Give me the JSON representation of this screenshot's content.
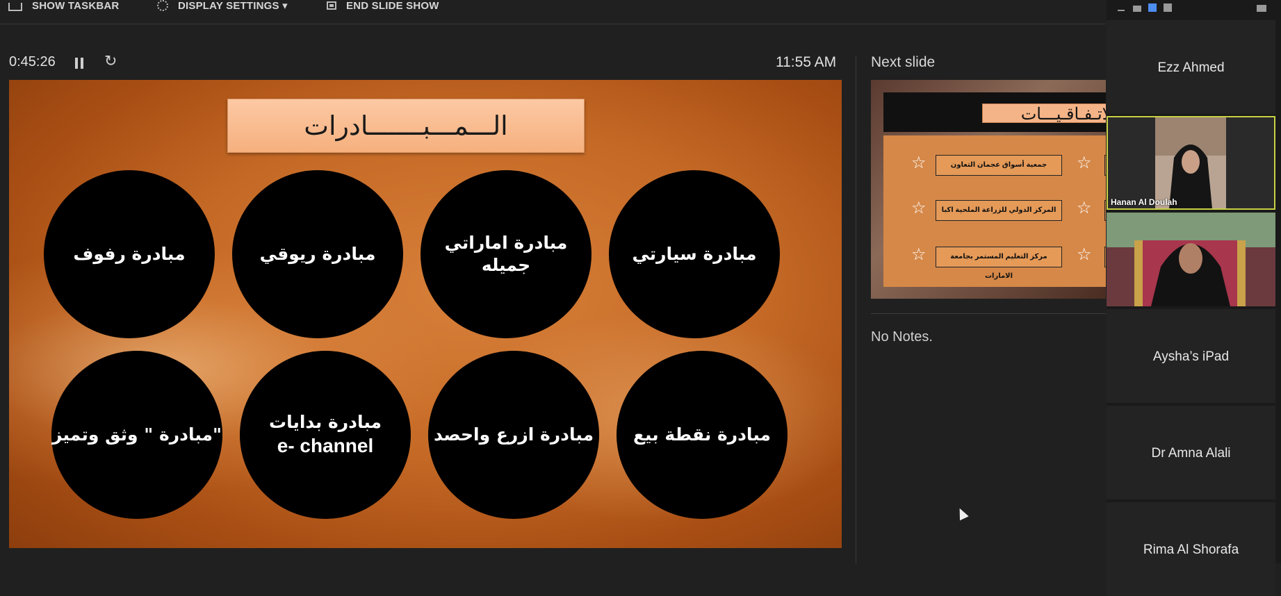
{
  "toolbar": {
    "show_taskbar": "SHOW TASKBAR",
    "display_settings": "DISPLAY SETTINGS ▾",
    "end_slide_show": "END SLIDE SHOW"
  },
  "presenter": {
    "timer": "0:45:26",
    "clock": "11:55 AM"
  },
  "current_slide": {
    "title": "الـــمـــبـــــــادرات",
    "initiatives": [
      {
        "text": "مبادرة رفوف"
      },
      {
        "text": "مبادرة ريوقي"
      },
      {
        "text": "مبادرة اماراتي جميله"
      },
      {
        "text": "مبادرة سيارتي"
      },
      {
        "text": "مبادرة \" وثق وتميز\""
      },
      {
        "line1": "مبادرة بدايات",
        "line2": "e- channel"
      },
      {
        "text": "مبادرة ازرع واحصد"
      },
      {
        "text": "مبادرة نقطة بيع"
      }
    ]
  },
  "next_slide": {
    "label": "Next slide",
    "title": "الاتـفـاقـيـــات",
    "rows": [
      "جمعية أسواق عجمان التعاون",
      "المركز الدولي للزراعة الملحية اكبا",
      "مركز التعليم المستمر بجامعة الامارات"
    ]
  },
  "notes": "No Notes.",
  "participants": [
    {
      "name": "Ezz Ahmed"
    },
    {
      "name": "Hanan Al Doulah"
    },
    {
      "name": ""
    },
    {
      "name": "Aysha’s iPad"
    },
    {
      "name": "Dr Amna Alali"
    },
    {
      "name": "Rima Al Shorafa"
    }
  ],
  "colors": {
    "background": "#202020",
    "slide_orange": "#c56a26",
    "active_speaker_border": "#c8d045"
  }
}
